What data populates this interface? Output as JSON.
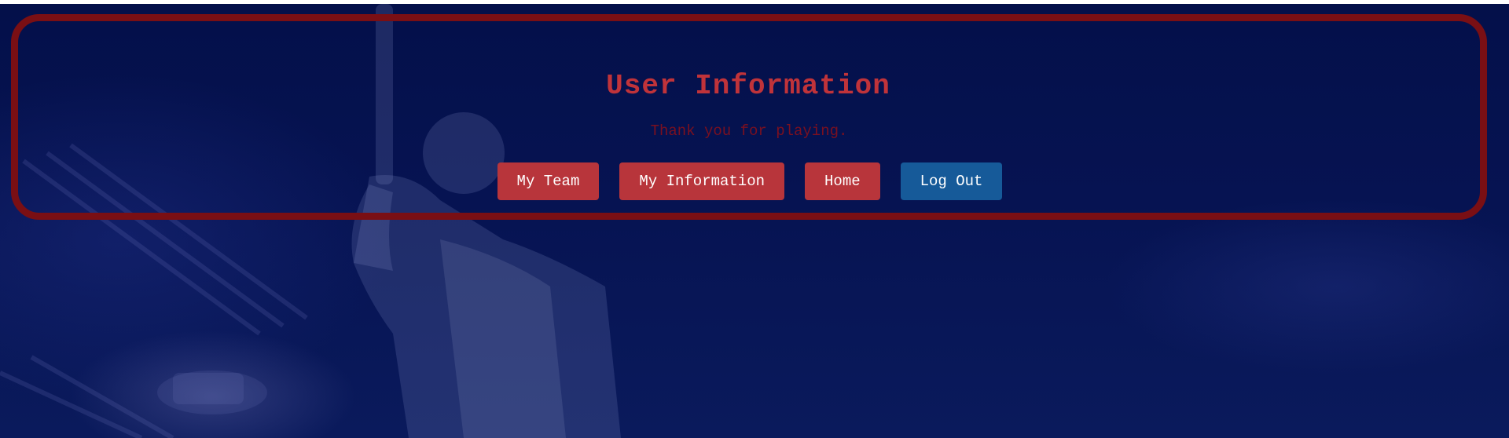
{
  "page": {
    "title": "User Information",
    "message": "Thank you for playing."
  },
  "nav": {
    "my_team": "My Team",
    "my_information": "My Information",
    "home": "Home",
    "log_out": "Log Out"
  },
  "colors": {
    "title": "#c0333a",
    "subtitle": "#7a1020",
    "panel_border": "#7a0f14",
    "button_red": "#b8353b",
    "button_blue": "#165a99",
    "background": "#061352"
  },
  "background_image": "cricket batsman in stadium under floodlights"
}
